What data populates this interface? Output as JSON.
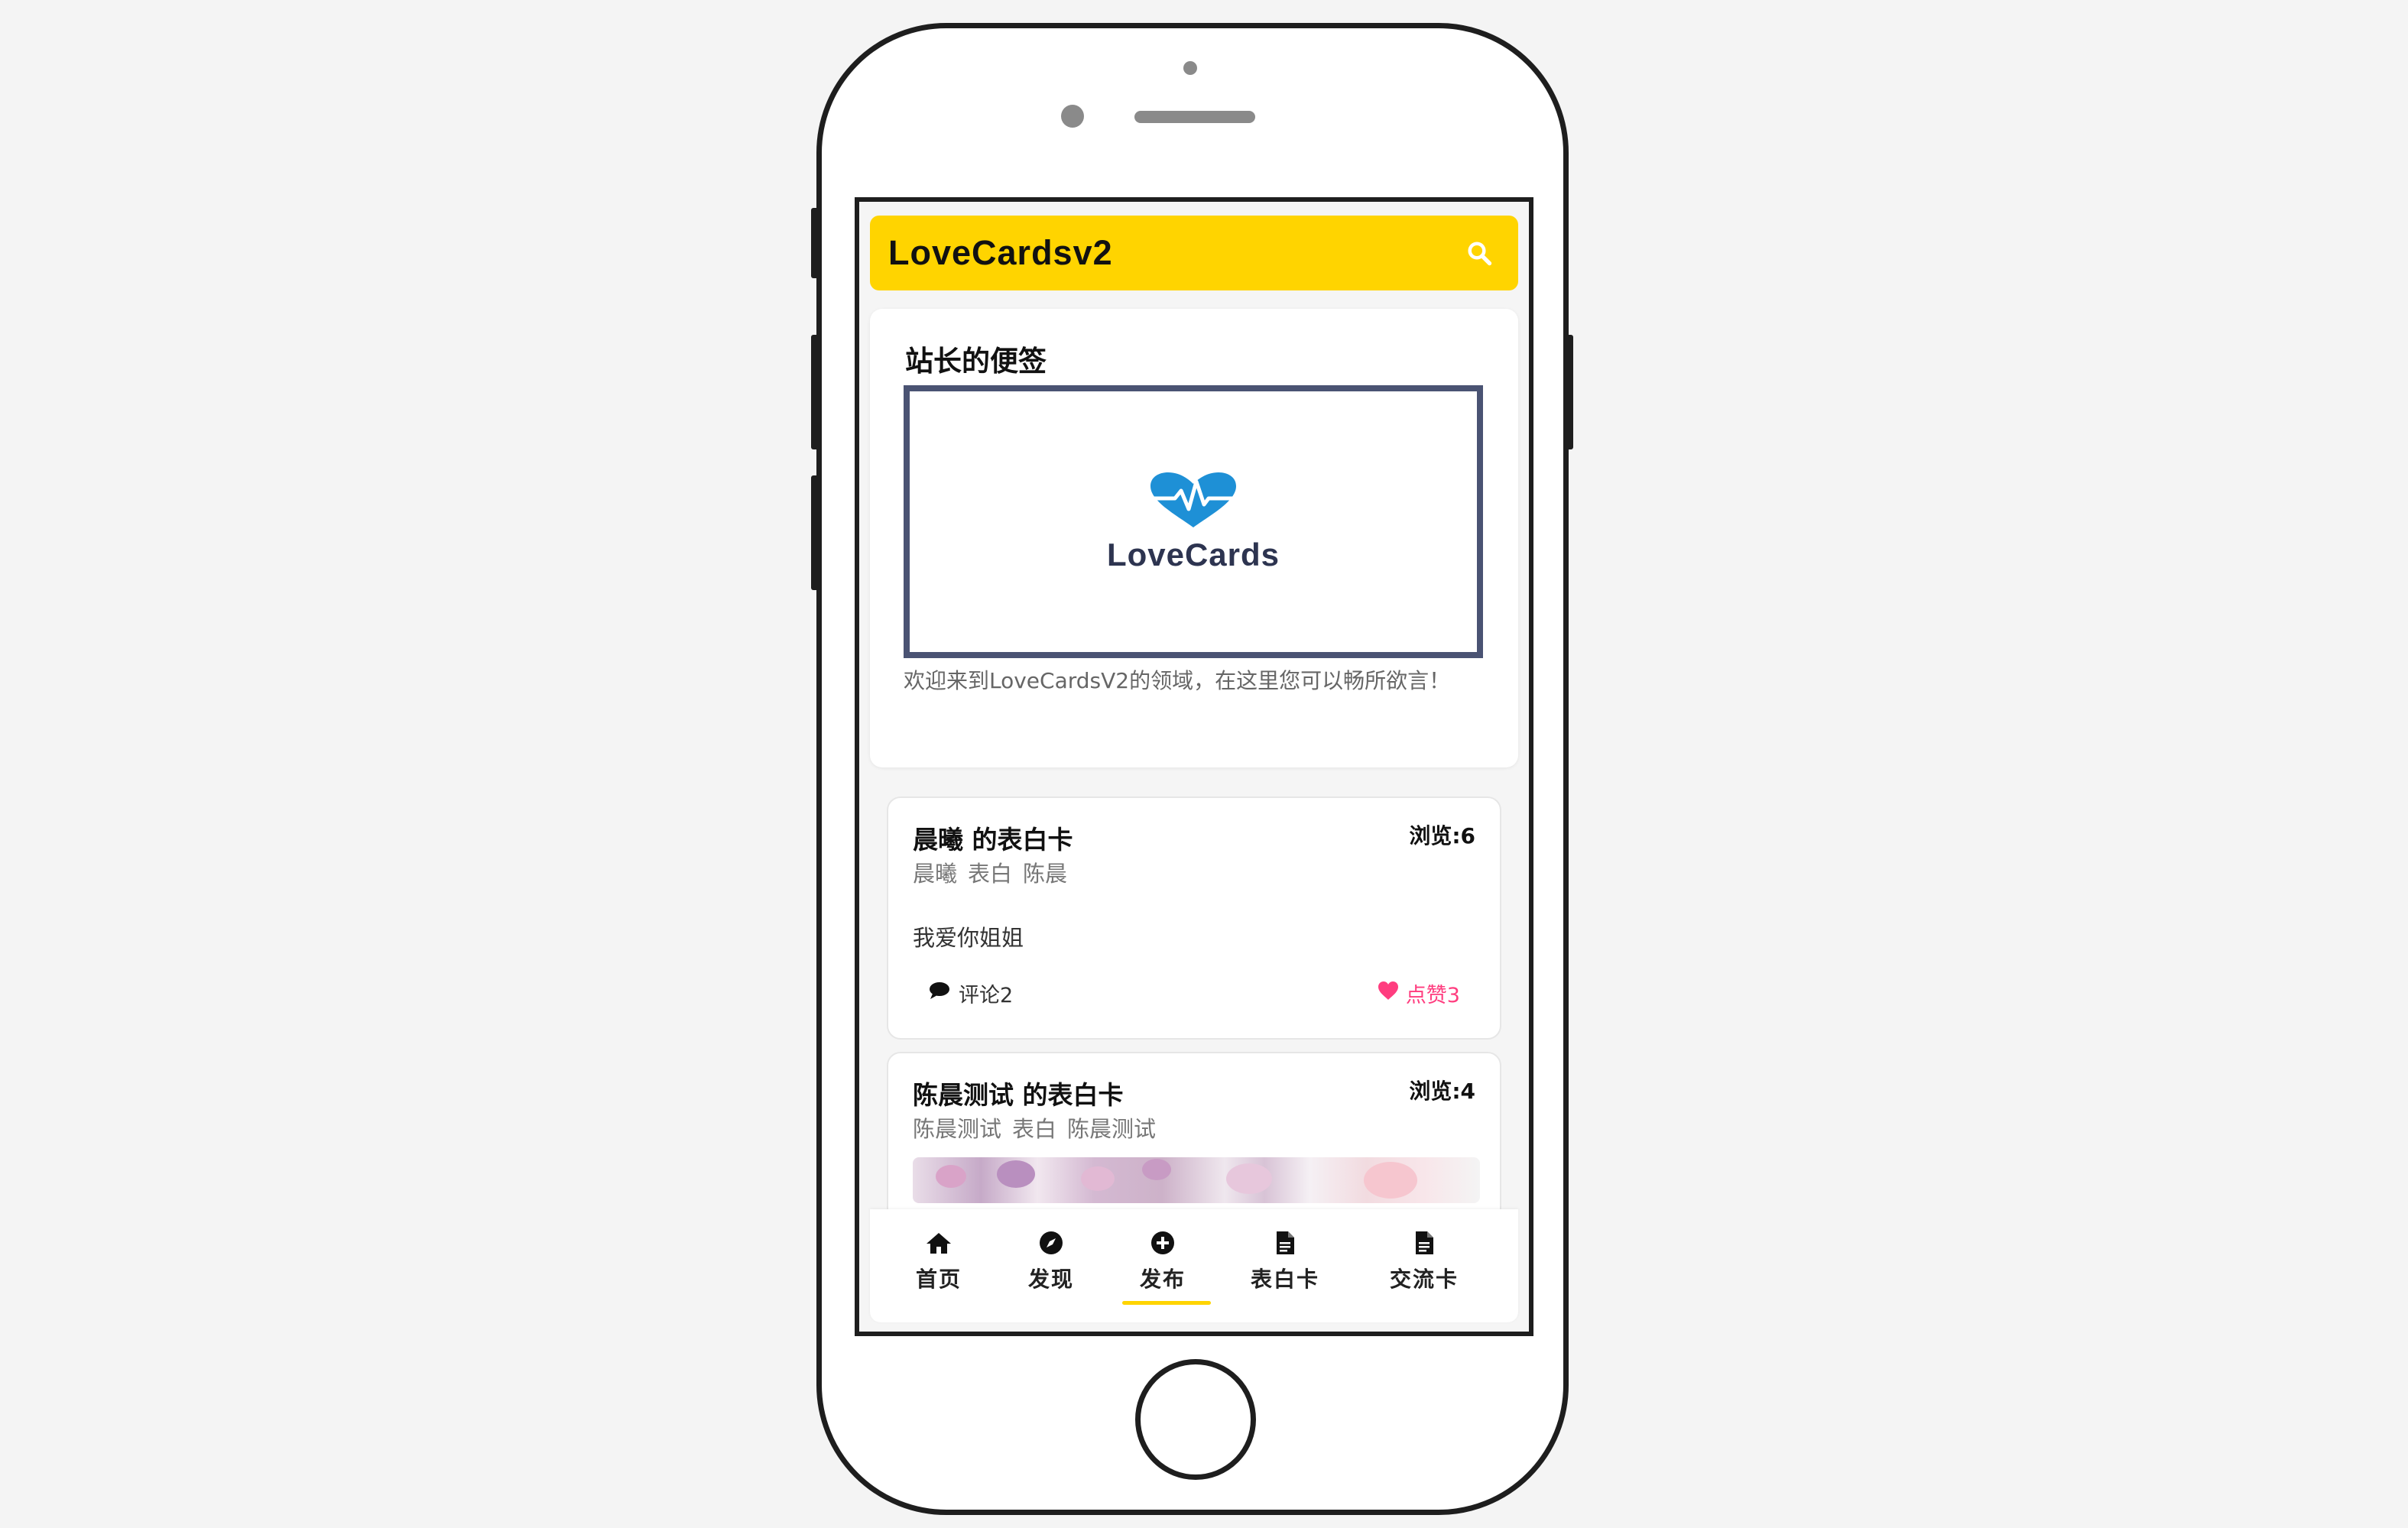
{
  "app": {
    "title": "LoveCardsv2",
    "accent_color": "#ffd400",
    "like_color": "#ff3d7f",
    "search_icon": "search-icon"
  },
  "notice": {
    "title": "站长的便签",
    "banner_text": "LoveCards",
    "banner_icon": "heart-pulse-icon",
    "banner_icon_color": "#1e90d6",
    "description": "欢迎来到LoveCardsV2的领域，在这里您可以畅所欲言！"
  },
  "posts": [
    {
      "title": "晨曦 的表白卡",
      "views": "浏览:6",
      "tags": [
        "晨曦",
        "表白",
        "陈晨"
      ],
      "body": "我爱你姐姐",
      "comment_label": "评论2",
      "comment_icon": "comment-icon",
      "like_label": "点赞3",
      "like_icon": "heart-icon"
    },
    {
      "title": "陈晨测试 的表白卡",
      "views": "浏览:4",
      "tags": [
        "陈晨测试",
        "表白",
        "陈晨测试"
      ],
      "image": "cherry-blossom-photo"
    }
  ],
  "nav": {
    "items": [
      {
        "label": "首页",
        "icon": "home-icon"
      },
      {
        "label": "发现",
        "icon": "compass-icon"
      },
      {
        "label": "发布",
        "icon": "plus-circle-icon"
      },
      {
        "label": "表白卡",
        "icon": "file-icon"
      },
      {
        "label": "交流卡",
        "icon": "file-icon"
      }
    ],
    "active_index": 2
  }
}
